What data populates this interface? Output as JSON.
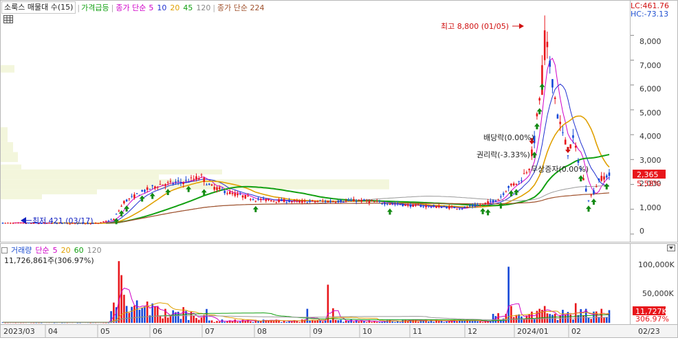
{
  "legend": {
    "name": "소룩스 매물대 수(15)",
    "price_spike": "가격급등",
    "ma_label": "종가 단순",
    "ma_periods": [
      "5",
      "10",
      "20",
      "45",
      "120"
    ],
    "ma_colors": [
      "#d000c8",
      "#1f2fd0",
      "#e0a000",
      "#12a012",
      "#888888"
    ],
    "long_ma_label": "종가 단순 224",
    "long_ma_color": "#a0522d"
  },
  "corner": {
    "lc": "LC:461.76",
    "hc": "HC:-73.13"
  },
  "annotations": {
    "high": "최고 8,800 (01/05)",
    "low": "최저 421 (03/17)",
    "dividend": "배당락(0.00%)",
    "rights": "권리락(-3.33%)",
    "bonus": "무상증자(0.00%)"
  },
  "price_panel": {
    "y_ticks": [
      "8,000",
      "7,000",
      "6,000",
      "5,000",
      "4,000",
      "3,000",
      "2,000",
      "1,000",
      "0"
    ],
    "last_price": "2,365",
    "last_change": "5.58%"
  },
  "volume_panel": {
    "legend_name": "거래량",
    "legend_ma": "단순",
    "legend_periods": [
      "5",
      "20",
      "60",
      "120"
    ],
    "info": "11,726,861주(306.97%)",
    "y_ticks": [
      "100,000K",
      "50,000K"
    ],
    "last_volume": "11,727K",
    "last_ratio": "306.97%"
  },
  "x_axis": [
    "2023/03",
    "04",
    "05",
    "06",
    "07",
    "08",
    "09",
    "10",
    "11",
    "12",
    "2024/01",
    "02",
    "02/23"
  ],
  "colors": {
    "up": "#e8161b",
    "down": "#1648d8",
    "profile": "#f3f6dc"
  },
  "chart_data": {
    "type": "candlestick",
    "title": "소룩스 매물대 수(15)",
    "y_range": [
      -200,
      9200
    ],
    "x_range": [
      "2023-03",
      "2024-02-23"
    ],
    "series": [
      {
        "name": "price_close_approx",
        "x": [
          "2023-03",
          "2023-04",
          "2023-05",
          "2023-05-25",
          "2023-06",
          "2023-06-20",
          "2023-07",
          "2023-07-10",
          "2023-08",
          "2023-09",
          "2023-10",
          "2023-11",
          "2023-11-20",
          "2023-12",
          "2023-12-20",
          "2024-01-02",
          "2024-01-05",
          "2024-01-10",
          "2024-01-20",
          "2024-02",
          "2024-02-10",
          "2024-02-23"
        ],
        "values": [
          450,
          430,
          450,
          1400,
          1900,
          2000,
          2300,
          1800,
          1300,
          1250,
          1100,
          1050,
          1000,
          1900,
          2200,
          5000,
          8800,
          5200,
          3500,
          1500,
          2200,
          2365
        ]
      },
      {
        "name": "5",
        "values": []
      },
      {
        "name": "10",
        "values": []
      },
      {
        "name": "20",
        "values": []
      },
      {
        "name": "45",
        "values": []
      },
      {
        "name": "120",
        "values": []
      },
      {
        "name": "종가 단순 224",
        "values": []
      }
    ],
    "volume_max": 120000,
    "markers": {
      "high": 8800,
      "low": 421
    }
  }
}
